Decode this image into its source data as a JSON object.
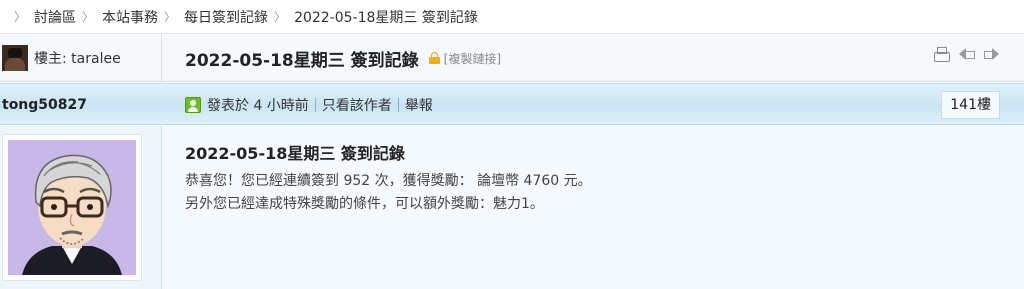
{
  "breadcrumb": [
    "討論區",
    "本站事務",
    "每日簽到記錄",
    "2022-05-18星期三 簽到記錄"
  ],
  "thread": {
    "op_label": "樓主: taralee",
    "title": "2022-05-18星期三 簽到記錄",
    "copy_link": "[複製鏈接]",
    "icons": [
      "print-icon",
      "arrow-left-icon",
      "arrow-right-icon"
    ]
  },
  "post": {
    "author": "tong50827",
    "posted": "發表於 4 小時前",
    "only_author": "只看該作者",
    "report": "舉報",
    "floor": "141樓",
    "title": "2022-05-18星期三 簽到記錄",
    "line1": "恭喜您！您已經連續簽到 952 次，獲得獎勵： 論壇幣 4760 元。",
    "line2": "另外您已經達成特殊獎勵的條件，可以額外獎勵：魅力1。"
  },
  "colors": {
    "header_strip": "#c8e5f3",
    "online_icon": "#6bbf2a",
    "lock_icon": "#f0b400",
    "avatar_bg": "#c8b8e8"
  }
}
